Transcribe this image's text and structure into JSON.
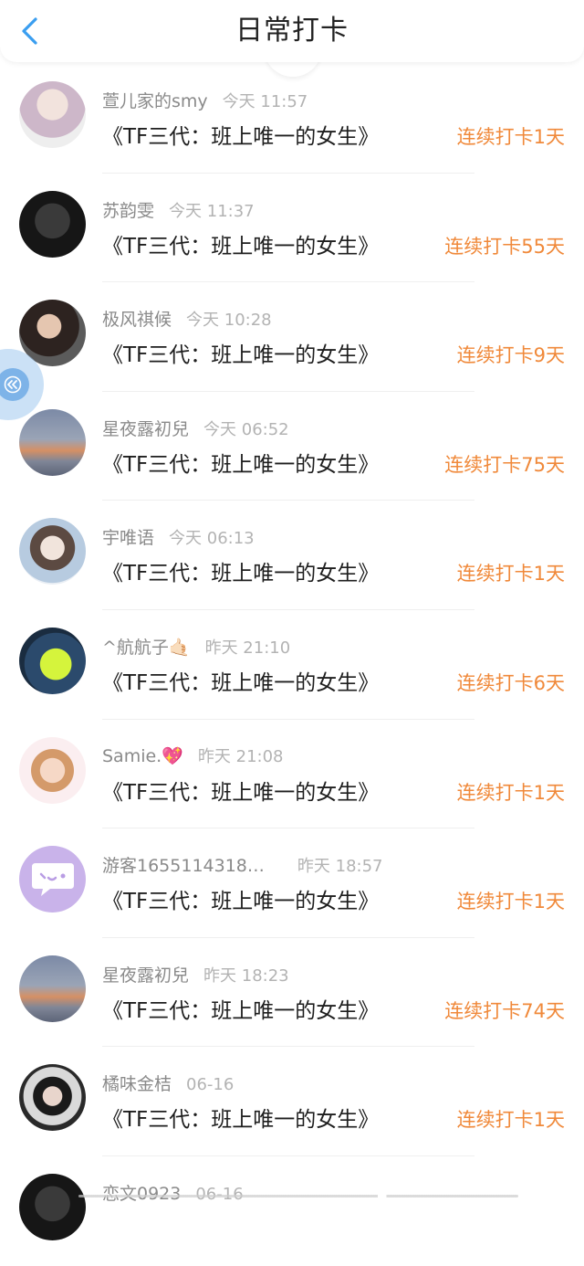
{
  "header": {
    "title": "日常打卡",
    "back_icon": "chevron-left-icon"
  },
  "accent_color": "#f0893a",
  "back_color": "#3a9ef0",
  "book_title": "《TF三代：班上唯一的女生》",
  "entries": [
    {
      "name": "萱儿家的smy",
      "time": "今天 11:57",
      "book": "《TF三代：班上唯一的女生》",
      "streak": "连续打卡1天",
      "avatar": "doll-avatar"
    },
    {
      "name": "苏韵雯",
      "time": "今天 11:37",
      "book": "《TF三代：班上唯一的女生》",
      "streak": "连续打卡55天",
      "avatar": "dark-avatar"
    },
    {
      "name": "极风祺候",
      "time": "今天 10:28",
      "book": "《TF三代：班上唯一的女生》",
      "streak": "连续打卡9天",
      "avatar": "boy-avatar"
    },
    {
      "name": "星夜露初兒",
      "time": "今天 06:52",
      "book": "《TF三代：班上唯一的女生》",
      "streak": "连续打卡75天",
      "avatar": "sky-avatar"
    },
    {
      "name": "宇唯语",
      "time": "今天 06:13",
      "book": "《TF三代：班上唯一的女生》",
      "streak": "连续打卡1天",
      "avatar": "girl-avatar"
    },
    {
      "name": "^航航子🤙🏻",
      "time": "昨天 21:10",
      "book": "《TF三代：班上唯一的女生》",
      "streak": "连续打卡6天",
      "avatar": "green-avatar"
    },
    {
      "name": "Samie.💖",
      "time": "昨天 21:08",
      "book": "《TF三代：班上唯一的女生》",
      "streak": "连续打卡1天",
      "avatar": "anime-avatar"
    },
    {
      "name": "游客1655114318…",
      "time": "昨天 18:57",
      "book": "《TF三代：班上唯一的女生》",
      "streak": "连续打卡1天",
      "avatar": "chat-bubble-avatar"
    },
    {
      "name": "星夜露初兒",
      "time": "昨天 18:23",
      "book": "《TF三代：班上唯一的女生》",
      "streak": "连续打卡74天",
      "avatar": "sky-avatar"
    },
    {
      "name": "橘味金桔",
      "time": "06-16",
      "book": "《TF三代：班上唯一的女生》",
      "streak": "连续打卡1天",
      "avatar": "cow-avatar"
    },
    {
      "name": "恋文0923",
      "time": "06-16",
      "book": "",
      "streak": "",
      "avatar": "dark-avatar"
    }
  ],
  "floating_button": {
    "icon": "collapse-left-icon"
  }
}
